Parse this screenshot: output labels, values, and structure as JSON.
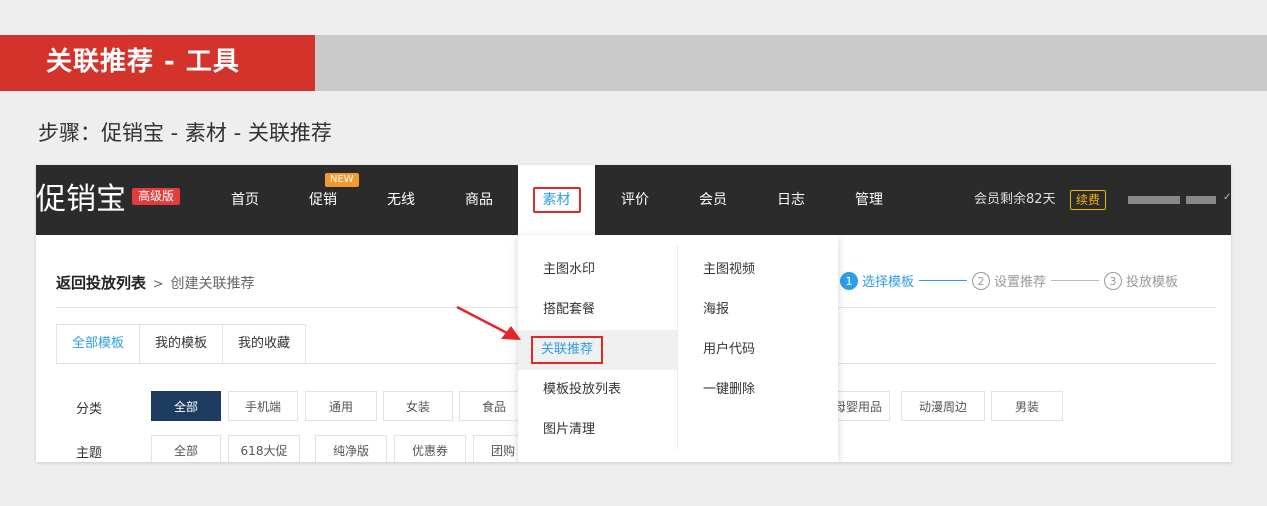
{
  "banner": {
    "title": "关联推荐 - 工具"
  },
  "steps": "步骤：促销宝 - 素材 - 关联推荐",
  "app": {
    "logo": "促销宝",
    "edition_badge": "高级版",
    "nav": [
      {
        "label": "首页"
      },
      {
        "label": "促销",
        "badge": "NEW"
      },
      {
        "label": "无线"
      },
      {
        "label": "商品"
      },
      {
        "label": "素材",
        "active": true
      },
      {
        "label": "评价"
      },
      {
        "label": "会员"
      },
      {
        "label": "日志"
      },
      {
        "label": "管理"
      }
    ],
    "member_remaining": "会员剩余82天",
    "renew": "续费"
  },
  "breadcrumb": {
    "back": "返回投放列表",
    "sep": ">",
    "current": "创建关联推荐"
  },
  "wizard": [
    {
      "num": "1",
      "label": "选择模板",
      "active": true
    },
    {
      "num": "2",
      "label": "设置推荐",
      "active": false
    },
    {
      "num": "3",
      "label": "投放模板",
      "active": false
    }
  ],
  "tabs": [
    {
      "label": "全部模板",
      "active": true
    },
    {
      "label": "我的模板"
    },
    {
      "label": "我的收藏"
    }
  ],
  "filters": {
    "category": {
      "label": "分类",
      "options_left": [
        "全部",
        "手机端",
        "通用",
        "女装",
        "食品"
      ],
      "options_right": [
        "母婴用品",
        "动漫周边",
        "男装"
      ],
      "selected": "全部"
    },
    "theme": {
      "label": "主题",
      "options": [
        "全部",
        "618大促",
        "纯净版",
        "优惠券",
        "团购"
      ]
    }
  },
  "dropdown": {
    "left": [
      "主图水印",
      "搭配套餐",
      "关联推荐",
      "模板投放列表",
      "图片清理"
    ],
    "right": [
      "主图视频",
      "海报",
      "用户代码",
      "一键删除"
    ],
    "highlighted": "关联推荐"
  },
  "colors": {
    "accent": "#2e9ee6",
    "brand_red": "#d3332b",
    "nav_bg": "#2b2b2b",
    "highlight_red": "#e0272a",
    "chip_selected": "#1e3c5e"
  }
}
